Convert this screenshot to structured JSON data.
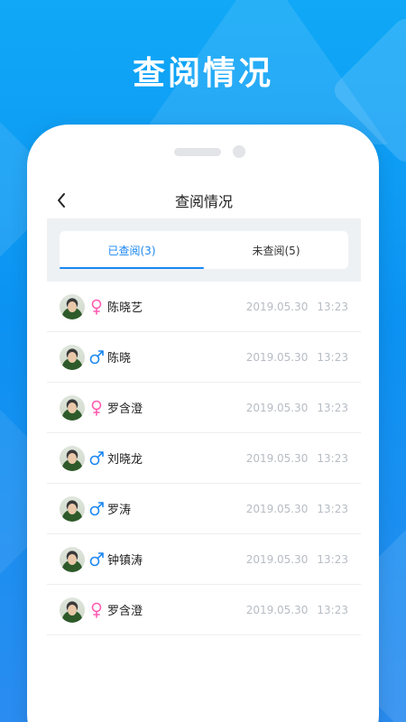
{
  "banner": {
    "title": "查阅情况"
  },
  "nav": {
    "title": "查阅情况",
    "back_icon": "chevron-left-icon"
  },
  "tabs": [
    {
      "label": "已查阅(3)",
      "active": true
    },
    {
      "label": "未查阅(5)",
      "active": false
    }
  ],
  "colors": {
    "accent": "#1a86f0",
    "female": "#ff5bb0",
    "male": "#1a86f0",
    "background": "#0c92f2"
  },
  "readers": [
    {
      "name": "陈晓艺",
      "gender": "female",
      "gender_icon": "female-icon",
      "date": "2019.05.30",
      "time": "13:23"
    },
    {
      "name": "陈晓",
      "gender": "male",
      "gender_icon": "male-icon",
      "date": "2019.05.30",
      "time": "13:23"
    },
    {
      "name": "罗含澄",
      "gender": "female",
      "gender_icon": "female-icon",
      "date": "2019.05.30",
      "time": "13:23"
    },
    {
      "name": "刘晓龙",
      "gender": "male",
      "gender_icon": "male-icon",
      "date": "2019.05.30",
      "time": "13:23"
    },
    {
      "name": "罗涛",
      "gender": "male",
      "gender_icon": "male-icon",
      "date": "2019.05.30",
      "time": "13:23"
    },
    {
      "name": "钟镇涛",
      "gender": "male",
      "gender_icon": "male-icon",
      "date": "2019.05.30",
      "time": "13:23"
    },
    {
      "name": "罗含澄",
      "gender": "female",
      "gender_icon": "female-icon",
      "date": "2019.05.30",
      "time": "13:23"
    }
  ]
}
